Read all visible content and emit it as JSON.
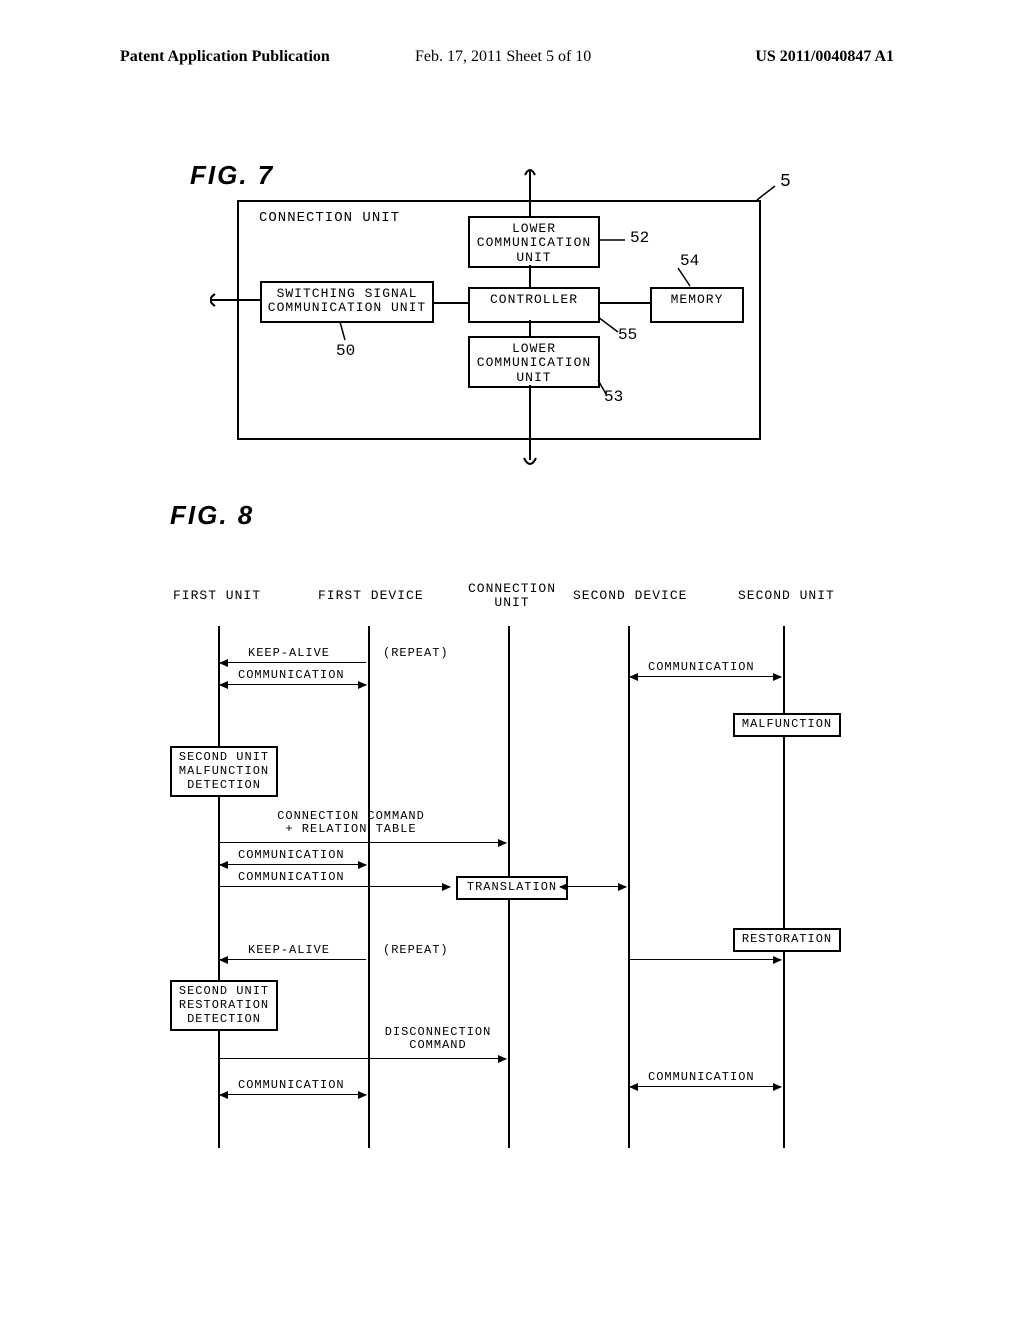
{
  "header": {
    "left": "Patent Application Publication",
    "center": "Feb. 17, 2011   Sheet 5 of 10",
    "right": "US 2011/0040847 A1"
  },
  "fig7": {
    "label": "FIG. 7",
    "frame_title": "CONNECTION UNIT",
    "switching_box": "SWITCHING SIGNAL\nCOMMUNICATION UNIT",
    "upper_comm": "LOWER\nCOMMUNICATION\nUNIT",
    "lower_comm": "LOWER\nCOMMUNICATION\nUNIT",
    "controller": "CONTROLLER",
    "memory": "MEMORY",
    "ref_5": "5",
    "ref_50": "50",
    "ref_52": "52",
    "ref_53": "53",
    "ref_54": "54",
    "ref_55": "55"
  },
  "fig8": {
    "label": "FIG. 8",
    "heads": {
      "first_unit": "FIRST UNIT",
      "first_device": "FIRST DEVICE",
      "connection_unit": "CONNECTION\nUNIT",
      "second_device": "SECOND DEVICE",
      "second_unit": "SECOND UNIT"
    },
    "msgs": {
      "keep_alive": "KEEP-ALIVE",
      "repeat": "(REPEAT)",
      "communication": "COMMUNICATION",
      "malfunction": "MALFUNCTION",
      "second_unit_malfunction_detection": "SECOND UNIT\nMALFUNCTION\nDETECTION",
      "connection_command_relation_table": "CONNECTION COMMAND\n+ RELATION TABLE",
      "translation": "TRANSLATION",
      "restoration": "RESTORATION",
      "second_unit_restoration_detection": "SECOND UNIT\nRESTORATION\nDETECTION",
      "disconnection_command": "DISCONNECTION\nCOMMAND"
    }
  }
}
